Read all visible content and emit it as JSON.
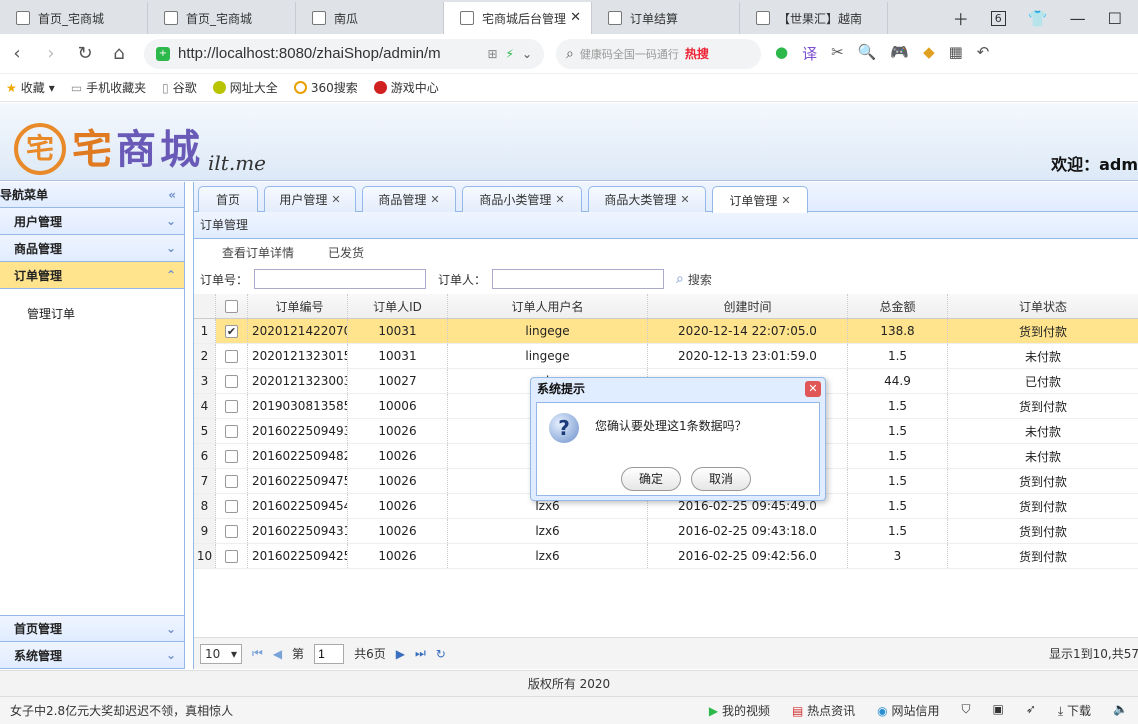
{
  "browser": {
    "tabs": [
      {
        "label": "首页_宅商城",
        "active": false
      },
      {
        "label": "首页_宅商城",
        "active": false
      },
      {
        "label": "南瓜",
        "active": false
      },
      {
        "label": "宅商城后台管理",
        "active": true
      },
      {
        "label": "订单结算",
        "active": false
      },
      {
        "label": "【世果汇】越南",
        "active": false
      }
    ],
    "tab_count": "6",
    "url": "http://localhost:8080/zhaiShop/admin/m",
    "search_placeholder": "健康码全国一码通行",
    "search_hot": "热搜",
    "bookmarks": [
      "收藏",
      "手机收藏夹",
      "谷歌",
      "网址大全",
      "360搜索",
      "游戏中心"
    ]
  },
  "app": {
    "logo_mark": "宅",
    "logo_text_a": "宅",
    "logo_text_b": "商",
    "logo_text_c": "城",
    "logo_sub": "ilt.me",
    "welcome": "欢迎：adm"
  },
  "sidebar": {
    "title": "导航菜单",
    "sections": {
      "user": "用户管理",
      "goods": "商品管理",
      "order": "订单管理",
      "home": "首页管理",
      "system": "系统管理"
    },
    "order_items": [
      "管理订单"
    ]
  },
  "main_tabs": [
    {
      "label": "首页",
      "closable": false
    },
    {
      "label": "用户管理",
      "closable": true
    },
    {
      "label": "商品管理",
      "closable": true
    },
    {
      "label": "商品小类管理",
      "closable": true
    },
    {
      "label": "商品大类管理",
      "closable": true
    },
    {
      "label": "订单管理",
      "closable": true,
      "active": true
    }
  ],
  "panel": {
    "title": "订单管理",
    "toolbar": {
      "view_detail": "查看订单详情",
      "shipped": "已发货"
    },
    "filter": {
      "order_no_label": "订单号：",
      "user_label": "订单人：",
      "search": "搜索"
    }
  },
  "grid": {
    "columns": [
      "订单编号",
      "订单人ID",
      "订单人用户名",
      "创建时间",
      "总金额",
      "订单状态"
    ],
    "rows": [
      {
        "rn": "1",
        "checked": true,
        "id": "2020121422070",
        "uid": "10031",
        "uname": "lingege",
        "time": "2020-12-14 22:07:05.0",
        "amount": "138.8",
        "status": "货到付款"
      },
      {
        "rn": "2",
        "checked": false,
        "id": "2020121323015",
        "uid": "10031",
        "uname": "lingege",
        "time": "2020-12-13 23:01:59.0",
        "amount": "1.5",
        "status": "未付款"
      },
      {
        "rn": "3",
        "checked": false,
        "id": "2020121323003",
        "uid": "10027",
        "uname": "l",
        "time": "",
        "amount": "44.9",
        "status": "已付款"
      },
      {
        "rn": "4",
        "checked": false,
        "id": "2019030813585",
        "uid": "10006",
        "uname": "",
        "time": "",
        "amount": "1.5",
        "status": "货到付款"
      },
      {
        "rn": "5",
        "checked": false,
        "id": "2016022509493",
        "uid": "10026",
        "uname": "",
        "time": "",
        "amount": "1.5",
        "status": "未付款"
      },
      {
        "rn": "6",
        "checked": false,
        "id": "2016022509482",
        "uid": "10026",
        "uname": "",
        "time": "",
        "amount": "1.5",
        "status": "未付款"
      },
      {
        "rn": "7",
        "checked": false,
        "id": "2016022509475",
        "uid": "10026",
        "uname": "",
        "time": "",
        "amount": "1.5",
        "status": "货到付款"
      },
      {
        "rn": "8",
        "checked": false,
        "id": "2016022509454",
        "uid": "10026",
        "uname": "lzx6",
        "time": "2016-02-25 09:45:49.0",
        "amount": "1.5",
        "status": "货到付款"
      },
      {
        "rn": "9",
        "checked": false,
        "id": "2016022509431",
        "uid": "10026",
        "uname": "lzx6",
        "time": "2016-02-25 09:43:18.0",
        "amount": "1.5",
        "status": "货到付款"
      },
      {
        "rn": "10",
        "checked": false,
        "id": "2016022509425",
        "uid": "10026",
        "uname": "lzx6",
        "time": "2016-02-25 09:42:56.0",
        "amount": "3",
        "status": "货到付款"
      }
    ]
  },
  "pager": {
    "page_size": "10",
    "page_label_pre": "第",
    "page_value": "1",
    "page_label_post": "共6页",
    "info": "显示1到10,共57"
  },
  "modal": {
    "title": "系统提示",
    "message": "您确认要处理这1条数据吗？",
    "ok": "确定",
    "cancel": "取消"
  },
  "footer": "版权所有 2020",
  "statusbar": {
    "news": "女子中2.8亿元大奖却迟迟不领，真相惊人",
    "items": [
      "我的视频",
      "热点资讯",
      "网站信用",
      "下载"
    ]
  }
}
